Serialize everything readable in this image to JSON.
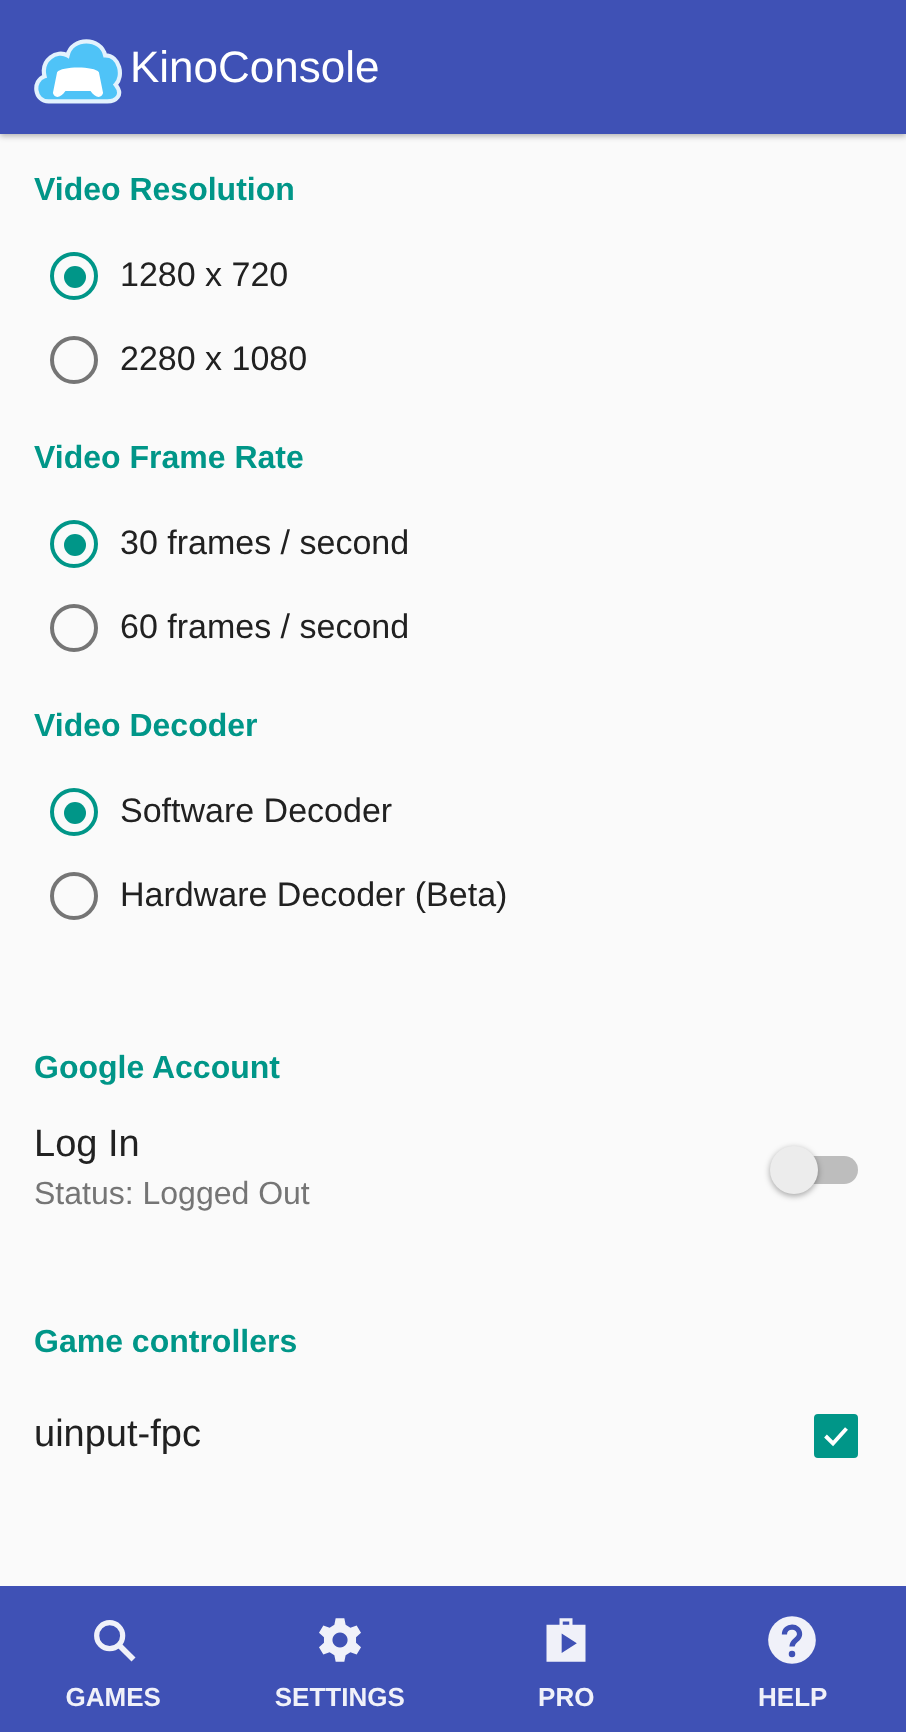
{
  "app_bar": {
    "title": "KinoConsole"
  },
  "sections": [
    {
      "title": "Video Resolution",
      "kind": "radio",
      "options": [
        {
          "label": "1280 x 720",
          "selected": true
        },
        {
          "label": "2280 x 1080",
          "selected": false
        }
      ]
    },
    {
      "title": "Video Frame Rate",
      "kind": "radio",
      "options": [
        {
          "label": "30 frames / second",
          "selected": true
        },
        {
          "label": "60 frames / second",
          "selected": false
        }
      ]
    },
    {
      "title": "Video Decoder",
      "kind": "radio",
      "options": [
        {
          "label": "Software Decoder",
          "selected": true
        },
        {
          "label": "Hardware Decoder (Beta)",
          "selected": false
        }
      ]
    },
    {
      "title": "Google Account",
      "kind": "switch",
      "label": "Log In",
      "summary": "Status: Logged Out",
      "on": false
    },
    {
      "title": "Game controllers",
      "kind": "checkbox",
      "label": "uinput-fpc",
      "checked": true
    }
  ],
  "bottom_nav": [
    {
      "label": "GAMES",
      "selected": false
    },
    {
      "label": "SETTINGS",
      "selected": false
    },
    {
      "label": "PRO",
      "selected": false
    },
    {
      "label": "HELP",
      "selected": false
    }
  ]
}
